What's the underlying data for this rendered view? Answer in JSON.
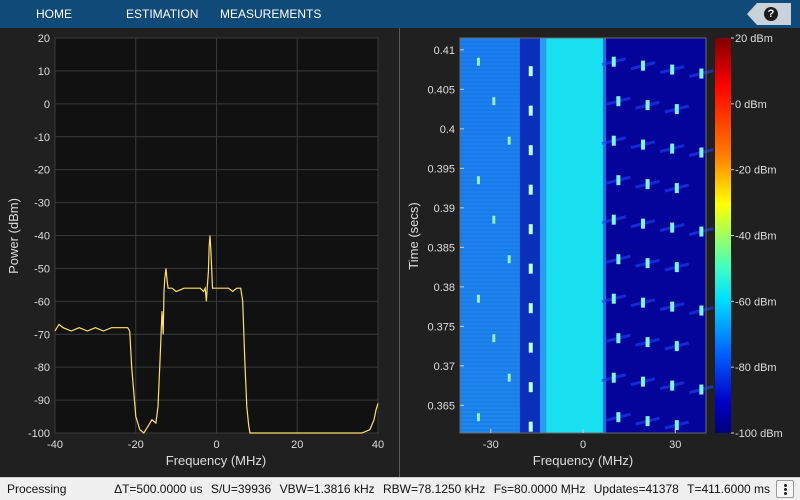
{
  "toolbar": {
    "tabs": [
      "HOME",
      "ESTIMATION",
      "MEASUREMENTS"
    ],
    "help_icon": "help-icon",
    "help_glyph": "?"
  },
  "spectrum": {
    "ylabel": "Power (dBm)",
    "xlabel": "Frequency (MHz)",
    "trace_color": "#ffe066"
  },
  "spectrogram": {
    "ylabel": "Time (secs)",
    "xlabel": "Frequency (MHz)",
    "colorbar_ticks": [
      "20 dBm",
      "0 dBm",
      "-20 dBm",
      "-40 dBm",
      "-60 dBm",
      "-80 dBm",
      "-100 dBm"
    ]
  },
  "chart_data": [
    {
      "type": "line",
      "xlabel": "Frequency (MHz)",
      "ylabel": "Power (dBm)",
      "xlim": [
        -40,
        40
      ],
      "ylim": [
        -100,
        20
      ],
      "x_ticks": [
        "-40",
        "-20",
        "0",
        "20",
        "40"
      ],
      "y_ticks": [
        "20",
        "10",
        "0",
        "-10",
        "-20",
        "-30",
        "-40",
        "-50",
        "-60",
        "-70",
        "-80",
        "-90",
        "-100"
      ],
      "grid": true,
      "x": [
        -40,
        -39,
        -38,
        -36,
        -34,
        -32,
        -30,
        -28,
        -26,
        -24,
        -22,
        -21.5,
        -21,
        -20,
        -19,
        -18,
        -17,
        -16,
        -15,
        -14.5,
        -14,
        -13.5,
        -13.2,
        -13,
        -12.8,
        -12.5,
        -12.2,
        -12,
        -11.5,
        -11,
        -10,
        -8,
        -6,
        -4,
        -3.2,
        -2.8,
        -2.5,
        -2.3,
        -2,
        -1.8,
        -1.6,
        -1.4,
        -1,
        0,
        1,
        2,
        3,
        4,
        5,
        6,
        6.5,
        7,
        7.5,
        8,
        8.3,
        8.6,
        9,
        9.5,
        10,
        11,
        12,
        14,
        20,
        30,
        36,
        38,
        39,
        39.5,
        40
      ],
      "y": [
        -69,
        -67,
        -68,
        -69,
        -68,
        -69,
        -68,
        -69,
        -68,
        -68,
        -68,
        -69,
        -80,
        -95,
        -99,
        -100,
        -98,
        -96,
        -97,
        -92,
        -78,
        -63,
        -70,
        -57,
        -53,
        -50,
        -54,
        -56,
        -56,
        -56,
        -57,
        -56,
        -56,
        -56,
        -57,
        -56,
        -60,
        -56,
        -51,
        -43,
        -40,
        -44,
        -56,
        -56,
        -56,
        -56,
        -56,
        -57,
        -56,
        -56,
        -60,
        -78,
        -92,
        -98,
        -100,
        -100,
        -100,
        -100,
        -100,
        -100,
        -100,
        -100,
        -100,
        -100,
        -100,
        -99,
        -96,
        -93,
        -91
      ]
    },
    {
      "type": "heatmap",
      "xlabel": "Frequency (MHz)",
      "ylabel": "Time (secs)",
      "xlim": [
        -40,
        40
      ],
      "ylim": [
        0.3615,
        0.4115
      ],
      "x_ticks": [
        -30,
        0,
        30
      ],
      "y_ticks": [
        0.41,
        0.405,
        0.4,
        0.395,
        0.39,
        0.385,
        0.38,
        0.375,
        0.37,
        0.365
      ],
      "colorbar": {
        "range_dbm": [
          -100,
          20
        ],
        "ticks": [
          "20 dBm",
          "0 dBm",
          "-20 dBm",
          "-40 dBm",
          "-60 dBm",
          "-80 dBm",
          "-100 dBm"
        ]
      }
    }
  ],
  "status": {
    "state": "Processing",
    "items": [
      "ΔT=500.0000 us",
      "S/U=39936",
      "VBW=1.3816 kHz",
      "RBW=78.1250 kHz",
      "Fs=80.0000 MHz",
      "Updates=41378",
      "T=411.6000 ms"
    ],
    "menu_icon": "vertical-ellipsis-icon"
  }
}
